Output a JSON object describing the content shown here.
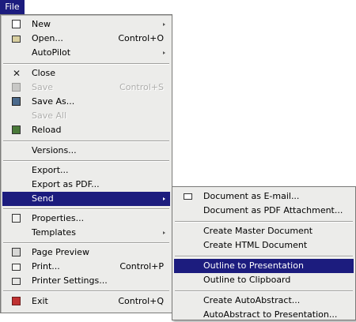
{
  "menubar": {
    "file_label": "File"
  },
  "file_menu": {
    "items": [
      {
        "label": "New",
        "shortcut": "",
        "icon": "new-document-icon"
      },
      {
        "label": "Open...",
        "shortcut": "Control+O",
        "icon": "folder-open-icon"
      },
      {
        "label": "AutoPilot",
        "shortcut": "",
        "icon": ""
      },
      {
        "label": "Close",
        "shortcut": "",
        "icon": "close-icon"
      },
      {
        "label": "Save",
        "shortcut": "Control+S",
        "icon": "save-icon"
      },
      {
        "label": "Save As...",
        "shortcut": "",
        "icon": "save-as-icon"
      },
      {
        "label": "Save All",
        "shortcut": "",
        "icon": ""
      },
      {
        "label": "Reload",
        "shortcut": "",
        "icon": "reload-icon"
      },
      {
        "label": "Versions...",
        "shortcut": "",
        "icon": ""
      },
      {
        "label": "Export...",
        "shortcut": "",
        "icon": ""
      },
      {
        "label": "Export as PDF...",
        "shortcut": "",
        "icon": ""
      },
      {
        "label": "Send",
        "shortcut": "",
        "icon": ""
      },
      {
        "label": "Properties...",
        "shortcut": "",
        "icon": "properties-icon"
      },
      {
        "label": "Templates",
        "shortcut": "",
        "icon": ""
      },
      {
        "label": "Page Preview",
        "shortcut": "",
        "icon": "page-preview-icon"
      },
      {
        "label": "Print...",
        "shortcut": "Control+P",
        "icon": "print-icon"
      },
      {
        "label": "Printer Settings...",
        "shortcut": "",
        "icon": "printer-settings-icon"
      },
      {
        "label": "Exit",
        "shortcut": "Control+Q",
        "icon": "exit-icon"
      }
    ]
  },
  "send_menu": {
    "items": [
      {
        "label": "Document as E-mail...",
        "icon": "mail-icon"
      },
      {
        "label": "Document as PDF Attachment..."
      },
      {
        "label": "Create Master Document"
      },
      {
        "label": "Create HTML Document"
      },
      {
        "label": "Outline to Presentation"
      },
      {
        "label": "Outline to Clipboard"
      },
      {
        "label": "Create AutoAbstract..."
      },
      {
        "label": "AutoAbstract to Presentation..."
      }
    ]
  },
  "colors": {
    "highlight": "#1c1c7e",
    "menu_background": "#ececea",
    "disabled_text": "#aeaeac"
  }
}
